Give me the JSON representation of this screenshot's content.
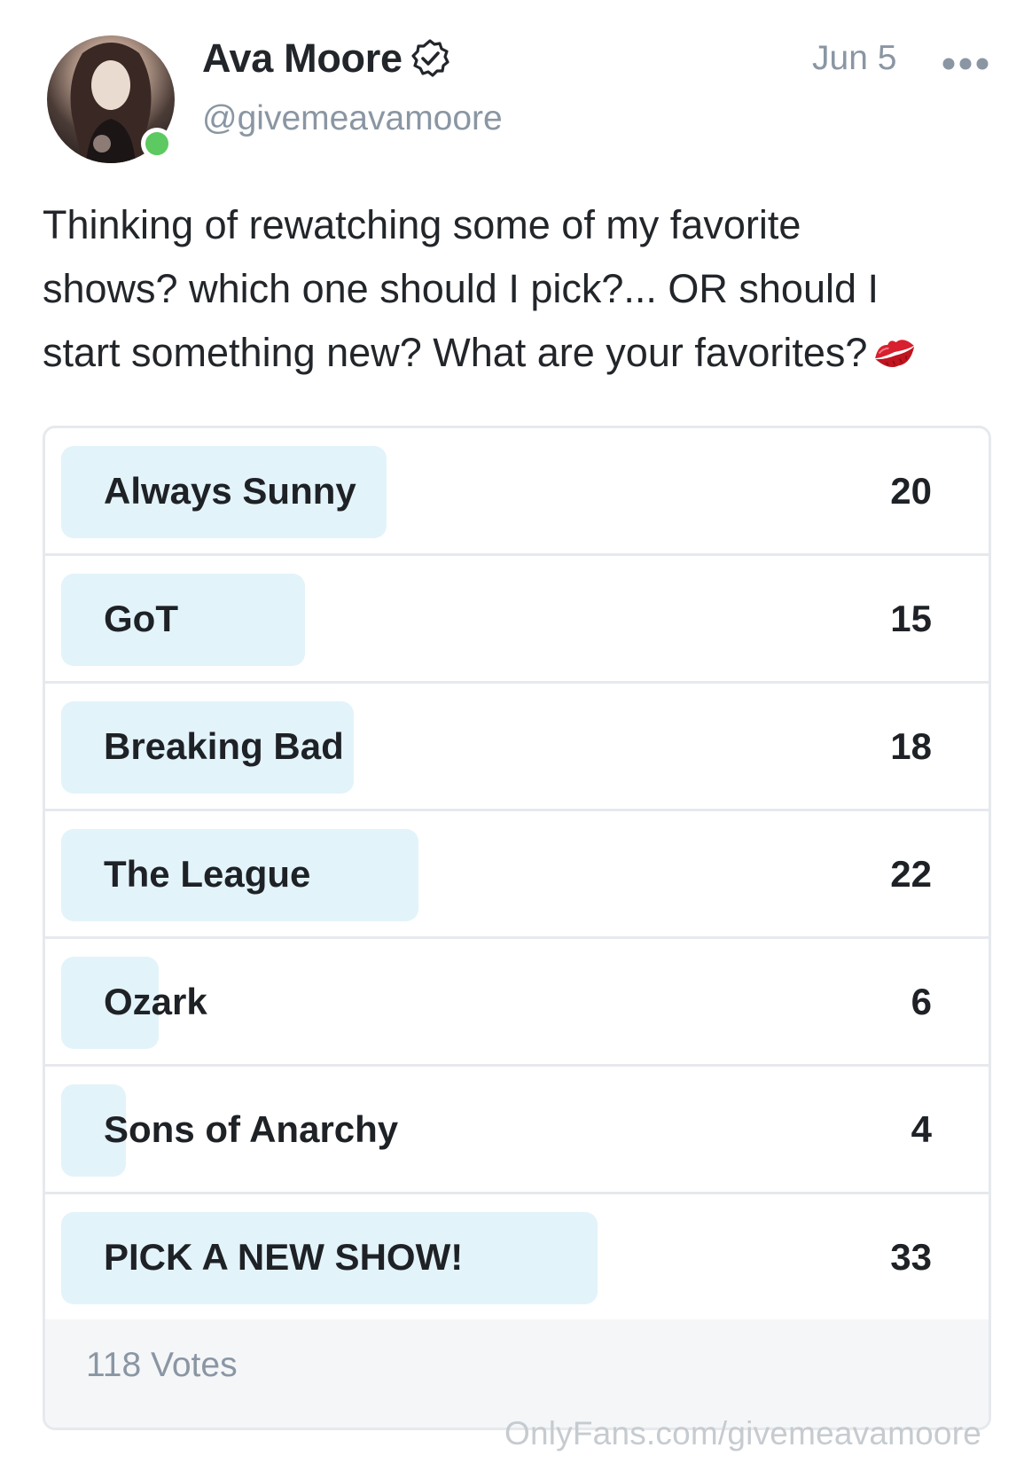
{
  "author": {
    "name": "Ava Moore",
    "handle": "@givemeavamoore",
    "verified": true,
    "online": true
  },
  "post": {
    "date": "Jun 5",
    "text_lines": [
      "Thinking of rewatching some of my favorite",
      "shows? which one should I pick?... OR should I",
      "start something new? What are your favorites?"
    ],
    "emoji": "kiss-mark-icon"
  },
  "poll": {
    "options": [
      {
        "label": "Always Sunny",
        "votes": "20",
        "share": 0.1695
      },
      {
        "label": "GoT",
        "votes": "15",
        "share": 0.1271
      },
      {
        "label": "Breaking Bad",
        "votes": "18",
        "share": 0.1525
      },
      {
        "label": "The League",
        "votes": "22",
        "share": 0.1864
      },
      {
        "label": "Ozark",
        "votes": "6",
        "share": 0.0508
      },
      {
        "label": "Sons of Anarchy",
        "votes": "4",
        "share": 0.0339
      },
      {
        "label": "PICK A NEW SHOW!",
        "votes": "33",
        "share": 0.2797
      }
    ],
    "total": "118 Votes"
  },
  "watermark": "OnlyFans.com/givemeavamoore",
  "colors": {
    "accent_fill": "#e3f3fa",
    "online": "#5dc961",
    "muted": "#8a96a3",
    "kiss": "#d8202e"
  }
}
